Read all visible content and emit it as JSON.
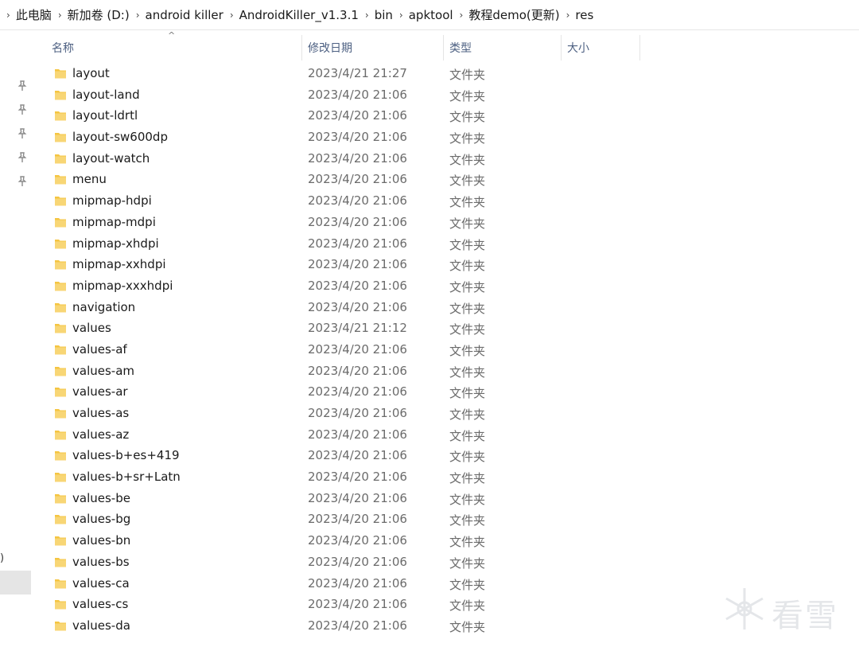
{
  "breadcrumb": [
    "此电脑",
    "新加卷 (D:)",
    "android killer",
    "AndroidKiller_v1.3.1",
    "bin",
    "apktool",
    "教程demo(更新)",
    "res"
  ],
  "columns": {
    "name": "名称",
    "date": "修改日期",
    "type": "类型",
    "size": "大小"
  },
  "nav": {
    "partial_text": ")"
  },
  "rows": [
    {
      "name": "layout",
      "date": "2023/4/21 21:27",
      "type": "文件夹",
      "size": ""
    },
    {
      "name": "layout-land",
      "date": "2023/4/20 21:06",
      "type": "文件夹",
      "size": ""
    },
    {
      "name": "layout-ldrtl",
      "date": "2023/4/20 21:06",
      "type": "文件夹",
      "size": ""
    },
    {
      "name": "layout-sw600dp",
      "date": "2023/4/20 21:06",
      "type": "文件夹",
      "size": ""
    },
    {
      "name": "layout-watch",
      "date": "2023/4/20 21:06",
      "type": "文件夹",
      "size": ""
    },
    {
      "name": "menu",
      "date": "2023/4/20 21:06",
      "type": "文件夹",
      "size": ""
    },
    {
      "name": "mipmap-hdpi",
      "date": "2023/4/20 21:06",
      "type": "文件夹",
      "size": ""
    },
    {
      "name": "mipmap-mdpi",
      "date": "2023/4/20 21:06",
      "type": "文件夹",
      "size": ""
    },
    {
      "name": "mipmap-xhdpi",
      "date": "2023/4/20 21:06",
      "type": "文件夹",
      "size": ""
    },
    {
      "name": "mipmap-xxhdpi",
      "date": "2023/4/20 21:06",
      "type": "文件夹",
      "size": ""
    },
    {
      "name": "mipmap-xxxhdpi",
      "date": "2023/4/20 21:06",
      "type": "文件夹",
      "size": ""
    },
    {
      "name": "navigation",
      "date": "2023/4/20 21:06",
      "type": "文件夹",
      "size": ""
    },
    {
      "name": "values",
      "date": "2023/4/21 21:12",
      "type": "文件夹",
      "size": ""
    },
    {
      "name": "values-af",
      "date": "2023/4/20 21:06",
      "type": "文件夹",
      "size": ""
    },
    {
      "name": "values-am",
      "date": "2023/4/20 21:06",
      "type": "文件夹",
      "size": ""
    },
    {
      "name": "values-ar",
      "date": "2023/4/20 21:06",
      "type": "文件夹",
      "size": ""
    },
    {
      "name": "values-as",
      "date": "2023/4/20 21:06",
      "type": "文件夹",
      "size": ""
    },
    {
      "name": "values-az",
      "date": "2023/4/20 21:06",
      "type": "文件夹",
      "size": ""
    },
    {
      "name": "values-b+es+419",
      "date": "2023/4/20 21:06",
      "type": "文件夹",
      "size": ""
    },
    {
      "name": "values-b+sr+Latn",
      "date": "2023/4/20 21:06",
      "type": "文件夹",
      "size": ""
    },
    {
      "name": "values-be",
      "date": "2023/4/20 21:06",
      "type": "文件夹",
      "size": ""
    },
    {
      "name": "values-bg",
      "date": "2023/4/20 21:06",
      "type": "文件夹",
      "size": ""
    },
    {
      "name": "values-bn",
      "date": "2023/4/20 21:06",
      "type": "文件夹",
      "size": ""
    },
    {
      "name": "values-bs",
      "date": "2023/4/20 21:06",
      "type": "文件夹",
      "size": ""
    },
    {
      "name": "values-ca",
      "date": "2023/4/20 21:06",
      "type": "文件夹",
      "size": ""
    },
    {
      "name": "values-cs",
      "date": "2023/4/20 21:06",
      "type": "文件夹",
      "size": ""
    },
    {
      "name": "values-da",
      "date": "2023/4/20 21:06",
      "type": "文件夹",
      "size": ""
    }
  ],
  "watermark": {
    "text": "看雪"
  },
  "icons": {
    "folder": "folder-icon",
    "pin": "pin-icon",
    "chevron": "chevron-right-icon",
    "sort": "sort-ascending-icon"
  },
  "colors": {
    "folder": "#f5c542",
    "header_text": "#4d6082",
    "secondary_text": "#6b6b6b"
  }
}
